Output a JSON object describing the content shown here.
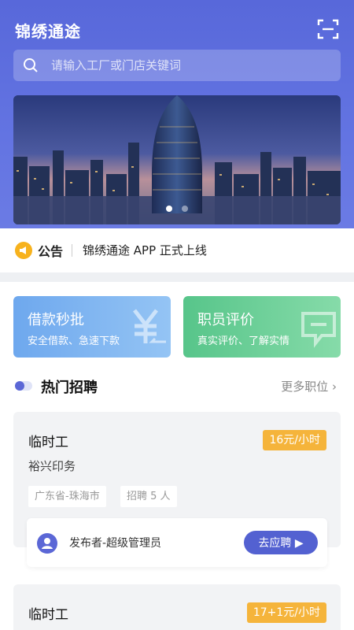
{
  "app": {
    "title": "锦绣通途"
  },
  "search": {
    "placeholder": "请输入工厂或门店关键词"
  },
  "notice": {
    "label": "公告",
    "text": "锦绣通途 APP 正式上线"
  },
  "cards": [
    {
      "title": "借款秒批",
      "subtitle": "安全借款、急速下款"
    },
    {
      "title": "职员评价",
      "subtitle": "真实评价、了解实情"
    }
  ],
  "section": {
    "title": "热门招聘",
    "more": "更多职位 ›"
  },
  "jobs": [
    {
      "title": "临时工",
      "pay": "16元/小时",
      "company": "裕兴印务",
      "tags": [
        "广东省-珠海市",
        "招聘 5 人"
      ],
      "publisher": "发布者-超级管理员",
      "apply_label": "去应聘 ▶"
    },
    {
      "title": "临时工",
      "pay": "17+1元/小时"
    }
  ],
  "colors": {
    "primary": "#5b67d6",
    "pay_badge": "#f5b43b",
    "loan_card": "#6ea8ee",
    "review_card": "#57c58a"
  }
}
